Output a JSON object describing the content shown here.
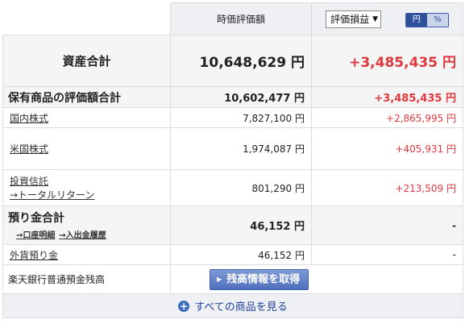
{
  "header": {
    "col_market_value": "時価評価額",
    "select_value": "評価損益",
    "toggle_yen": "円",
    "toggle_pct": "%"
  },
  "assets_total": {
    "label": "資産合計",
    "value": "10,648,629",
    "unit": "円",
    "gain": "+3,485,435",
    "gain_unit": "円"
  },
  "holdings": {
    "label": "保有商品の評価額合計",
    "value": "10,602,477",
    "unit": "円",
    "gain": "+3,485,435",
    "gain_unit": "円",
    "items": [
      {
        "label": "国内株式",
        "value": "7,827,100",
        "unit": "円",
        "gain": "+2,865,995",
        "gain_unit": "円"
      },
      {
        "label": "米国株式",
        "value": "1,974,087",
        "unit": "円",
        "gain": "+405,931",
        "gain_unit": "円"
      },
      {
        "label": "投資信託",
        "sublink": "→トータルリターン",
        "value": "801,290",
        "unit": "円",
        "gain": "+213,509",
        "gain_unit": "円"
      }
    ]
  },
  "deposits": {
    "label": "預り金合計",
    "link_account": "→口座明細",
    "link_transfer": "→入出金履歴",
    "value": "46,152",
    "unit": "円",
    "gain": "-",
    "items": [
      {
        "label": "外貨預り金",
        "value": "46,152",
        "unit": "円",
        "gain": "-"
      }
    ]
  },
  "bank": {
    "label": "楽天銀行普通預金残高",
    "button": "残高情報を取得"
  },
  "footer": {
    "see_all": "すべての商品を見る"
  },
  "colors": {
    "gain_red": "#e0383e",
    "header_bg": "#eef0f4",
    "accent_blue": "#2f4f9c"
  }
}
